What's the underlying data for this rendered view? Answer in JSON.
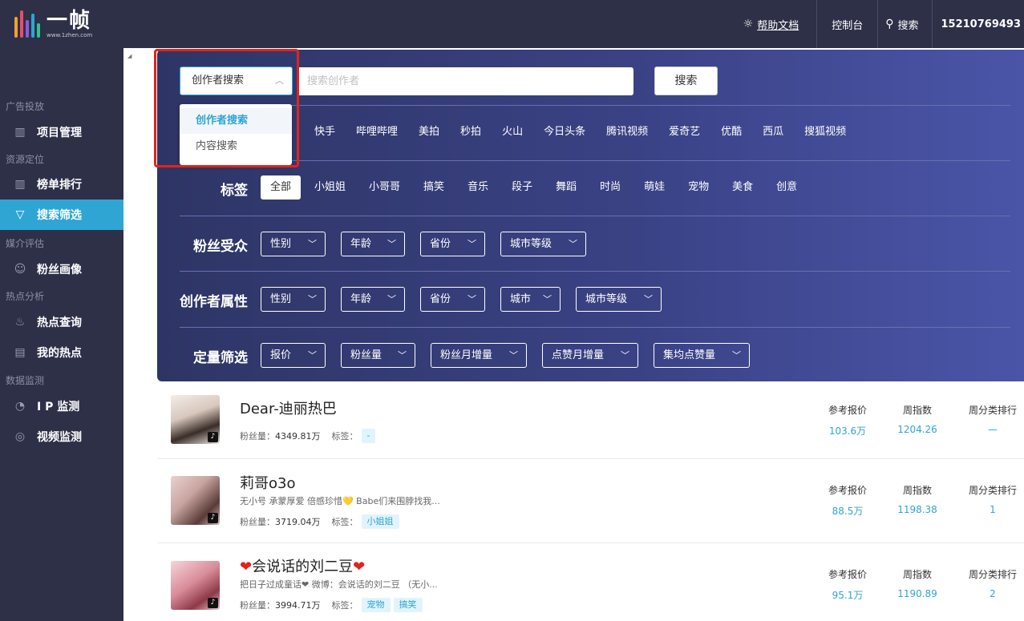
{
  "brand": {
    "name": "一帧",
    "url": "www.1zhen.com"
  },
  "topbar": {
    "help_label": "帮助文档",
    "console_label": "控制台",
    "search_label": "搜索",
    "user_phone": "15210769493"
  },
  "sidebar": {
    "groups": [
      {
        "title": "广告投放",
        "items": [
          {
            "label": "项目管理",
            "icon": "bar-chart-icon"
          }
        ]
      },
      {
        "title": "资源定位",
        "items": [
          {
            "label": "榜单排行",
            "icon": "bar-chart-icon"
          },
          {
            "label": "搜索筛选",
            "icon": "filter-icon",
            "active": true
          }
        ]
      },
      {
        "title": "媒介评估",
        "items": [
          {
            "label": "粉丝画像",
            "icon": "face-icon"
          }
        ]
      },
      {
        "title": "热点分析",
        "items": [
          {
            "label": "热点查询",
            "icon": "flame-icon"
          },
          {
            "label": "我的热点",
            "icon": "document-icon"
          }
        ]
      },
      {
        "title": "数据监测",
        "items": [
          {
            "label": "I P 监测",
            "icon": "pie-icon"
          },
          {
            "label": "视频监测",
            "icon": "video-monitor-icon"
          }
        ]
      }
    ]
  },
  "search": {
    "mode_selected": "创作者搜索",
    "mode_options": [
      "创作者搜索",
      "内容搜索"
    ],
    "placeholder": "搜索创作者",
    "button_label": "搜索"
  },
  "platforms": [
    "快手",
    "哔哩哔哩",
    "美拍",
    "秒拍",
    "火山",
    "今日头条",
    "腾讯视频",
    "爱奇艺",
    "优酷",
    "西瓜",
    "搜狐视频"
  ],
  "tags": {
    "label": "标签",
    "items": [
      "全部",
      "小姐姐",
      "小哥哥",
      "搞笑",
      "音乐",
      "段子",
      "舞蹈",
      "时尚",
      "萌娃",
      "宠物",
      "美食",
      "创意"
    ]
  },
  "fan_audience": {
    "label": "粉丝受众",
    "filters": [
      "性别",
      "年龄",
      "省份",
      "城市等级"
    ]
  },
  "creator_attrs": {
    "label": "创作者属性",
    "filters": [
      "性别",
      "年龄",
      "省份",
      "城市",
      "城市等级"
    ]
  },
  "quant": {
    "label": "定量筛选",
    "filters": [
      "报价",
      "粉丝量",
      "粉丝月增量",
      "点赞月增量",
      "集均点赞量"
    ]
  },
  "results_headers": {
    "price": "参考报价",
    "week_index": "周指数",
    "week_rank": "周分类排行"
  },
  "results": [
    {
      "name": "Dear-迪丽热巴",
      "desc": "",
      "fans_label": "粉丝量：",
      "fans": "4349.81万",
      "tag_label": "标签：",
      "tags": [
        "-"
      ],
      "price": "103.6万",
      "index": "1204.26",
      "rank": "—"
    },
    {
      "name": "莉哥o3o",
      "desc": "无小号 承蒙厚爱 倍感珍惜💛 Babe们来围脖找我...",
      "fans_label": "粉丝量：",
      "fans": "3719.04万",
      "tag_label": "标签：",
      "tags": [
        "小姐姐"
      ],
      "price": "88.5万",
      "index": "1198.38",
      "rank": "1"
    },
    {
      "name": "会说话的刘二豆",
      "desc": "把日子过成童话❤ 微博：会说话的刘二豆 （无小...",
      "fans_label": "粉丝量：",
      "fans": "3994.71万",
      "tag_label": "标签：",
      "tags": [
        "宠物",
        "搞笑"
      ],
      "price": "95.1万",
      "index": "1190.89",
      "rank": "2"
    }
  ],
  "colors": {
    "dark": "#2d3047",
    "accent": "#2fa5d4",
    "highlight_frame": "#e2231a"
  }
}
